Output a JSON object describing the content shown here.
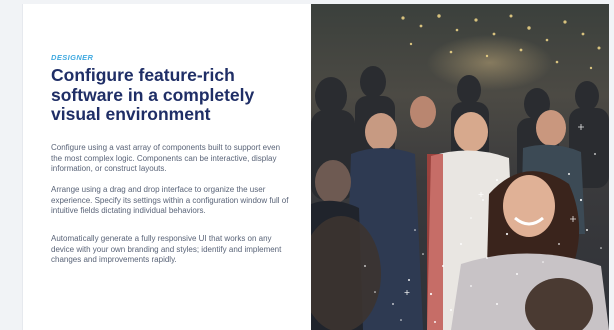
{
  "section": {
    "eyebrow": "DESIGNER",
    "headline": "Configure feature-rich software in a completely visual environment",
    "paragraphs": [
      "Configure using a vast array of components built to support even the most complex logic. Components can be interactive, display information, or construct layouts.",
      "Arrange using a drag and drop interface to organize the user experience. Specify its settings within a configuration window full of intuitive fields dictating individual behaviors.",
      "Automatically generate a fully responsive UI that works on any device with your own branding and styles; identify and implement changes and improvements rapidly."
    ]
  },
  "colors": {
    "eyebrow": "#3fa9e0",
    "headline": "#1f2e66",
    "body_text": "#5a6478"
  }
}
